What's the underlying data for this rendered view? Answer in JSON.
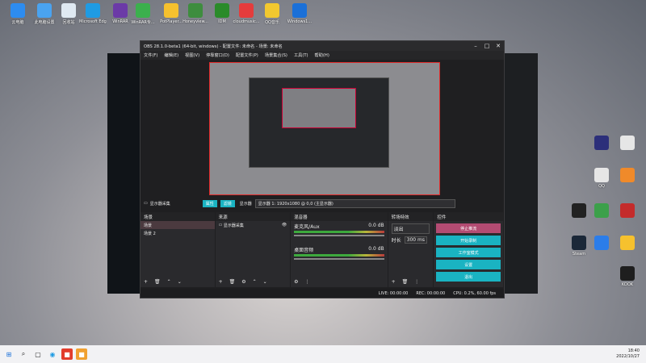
{
  "desktop": {
    "top_icons": [
      {
        "label": "云电脑",
        "icon": "computer-icon",
        "color": "#2d8cf0"
      },
      {
        "label": "此电脑设置",
        "icon": "settings-icon",
        "color": "#4aa3f0"
      },
      {
        "label": "回收站",
        "icon": "recycle-bin-icon",
        "color": "#dfe9f2"
      },
      {
        "label": "Microsoft Edge",
        "icon": "edge-icon",
        "color": "#1f9be3"
      },
      {
        "label": "WinRAR",
        "icon": "winrar-icon",
        "color": "#6b3aa7"
      },
      {
        "label": "WinRAR专...",
        "icon": "app-icon",
        "color": "#3bb04d"
      },
      {
        "label": "PotPlayer...",
        "icon": "potplayer-icon",
        "color": "#f6c12e"
      },
      {
        "label": "Honeyview...",
        "icon": "honeyview-icon",
        "color": "#3e8d3e"
      },
      {
        "label": "IDM",
        "icon": "idm-icon",
        "color": "#2a8b2a"
      },
      {
        "label": "cloudmusic...",
        "icon": "music-icon",
        "color": "#e43c3c"
      },
      {
        "label": "QQ音乐",
        "icon": "qq-music-icon",
        "color": "#f2c82f"
      },
      {
        "label": "Windows1...",
        "icon": "windows-icon",
        "color": "#1b70d8"
      }
    ],
    "right_icons": [
      {
        "label": "",
        "icon": "game-icon",
        "color": "#2c2f7a"
      },
      {
        "label": "",
        "icon": "app-icon",
        "color": "#e6e6e6"
      },
      {
        "label": "QQ",
        "icon": "qq-icon",
        "color": "#e6e6e6"
      },
      {
        "label": "",
        "icon": "app-icon",
        "color": "#f08a2a"
      },
      {
        "label": "",
        "icon": "app-icon",
        "color": "#222"
      },
      {
        "label": "",
        "icon": "app-icon",
        "color": "#3ca04a"
      },
      {
        "label": "",
        "icon": "app-icon",
        "color": "#c42b2b"
      },
      {
        "label": "Steam",
        "icon": "steam-icon",
        "color": "#1b2838"
      },
      {
        "label": "",
        "icon": "app-icon",
        "color": "#2b7de9"
      },
      {
        "label": "",
        "icon": "app-icon",
        "color": "#f6c12e"
      },
      {
        "label": "KOOK",
        "icon": "kook-icon",
        "color": "#1e1e1e"
      }
    ]
  },
  "obs": {
    "title": "OBS 28.1.0-beta1 (64-bit, windows) - 配置文件: 未命名 - 场景: 未命名",
    "menu": [
      "文件(F)",
      "编辑(E)",
      "视图(V)",
      "停靠窗口(D)",
      "配置文件(P)",
      "场景集合(S)",
      "工具(T)",
      "帮助(H)"
    ],
    "source_label": "显示器采集",
    "props_button": "属性",
    "filters_button": "滤镜",
    "display_label": "显示器",
    "display_value": "显示器 1: 1920x1080 @ 0,0 (主显示器)",
    "scenes": {
      "title": "场景",
      "items": [
        "场景",
        "场景 2"
      ]
    },
    "sources": {
      "title": "来源",
      "items": [
        "显示器采集"
      ]
    },
    "mixer": {
      "title": "混音器",
      "channels": [
        {
          "name": "麦克风/Aux",
          "db": "0.0 dB"
        },
        {
          "name": "桌面音频",
          "db": "0.0 dB"
        }
      ]
    },
    "transitions": {
      "title": "转场特效",
      "type": "淡出",
      "duration_label": "时长",
      "duration": "300 ms"
    },
    "controls": {
      "title": "控件",
      "buttons": [
        "停止推流",
        "开始录制",
        "工作室模式",
        "设置",
        "退出"
      ]
    },
    "status": {
      "live": "LIVE: 00:00:00",
      "rec": "REC: 00:00:00",
      "cpu": "CPU: 0.2%, 60.00 fps"
    }
  },
  "taskbar": {
    "time": "18:40",
    "date": "2022/10/27"
  }
}
